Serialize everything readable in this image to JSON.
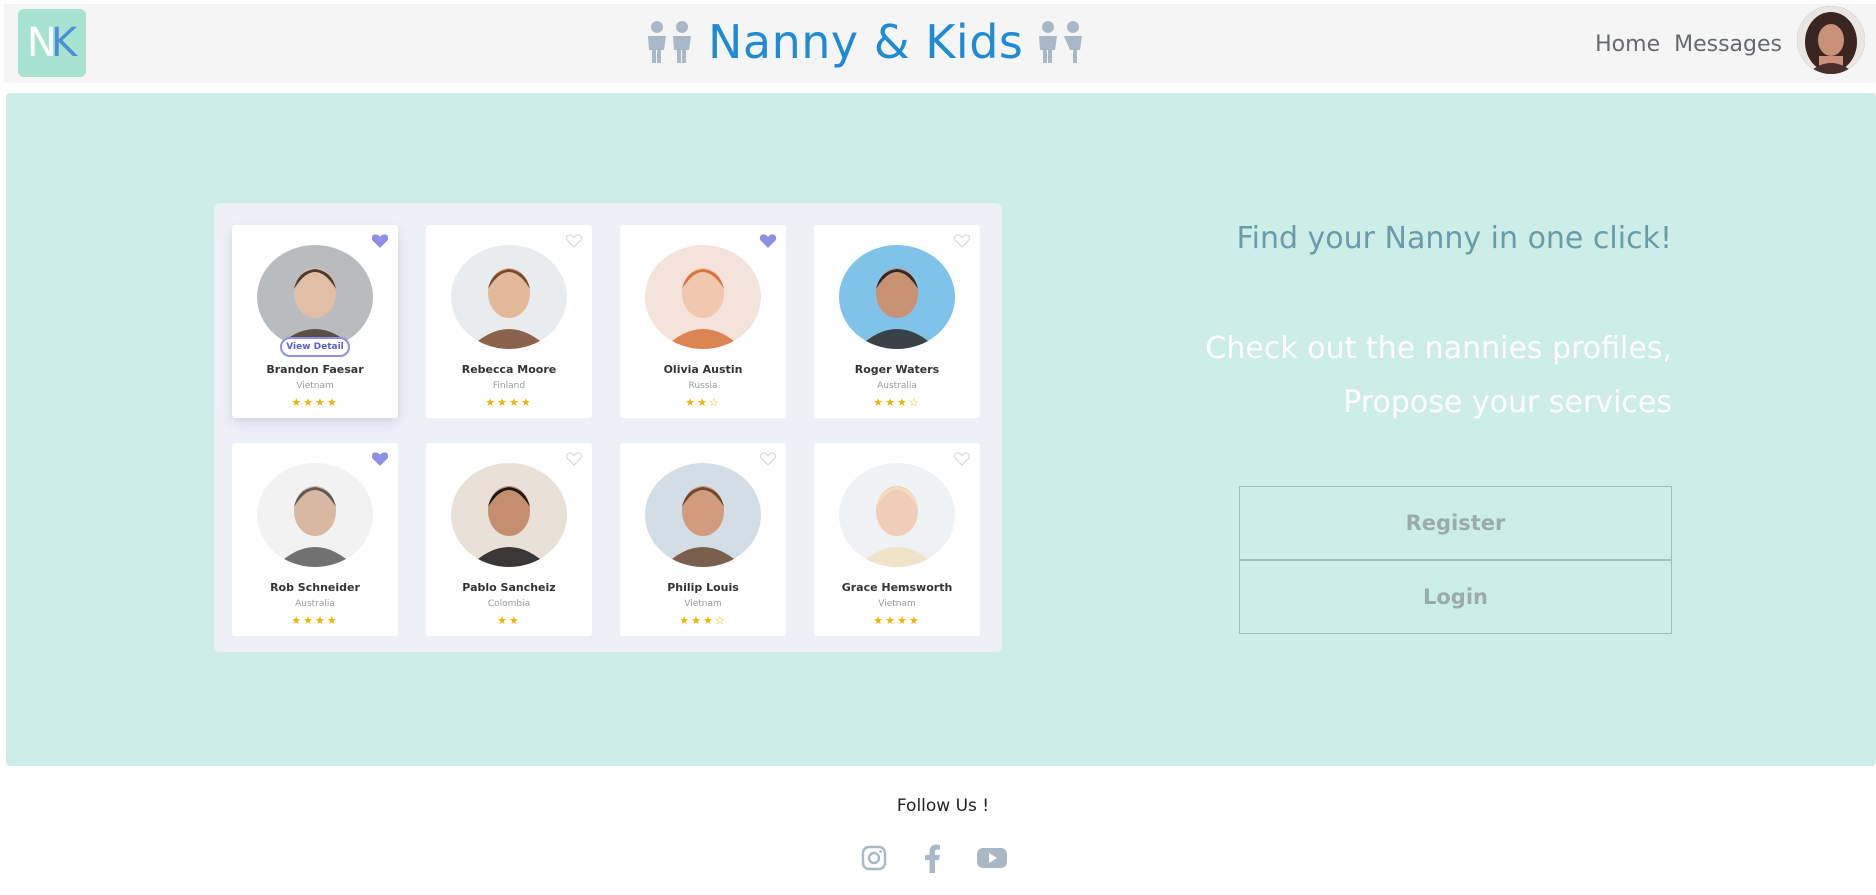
{
  "header": {
    "logo_n": "N",
    "logo_k": "K",
    "title": "Nanny & Kids",
    "nav": [
      {
        "label": "Home"
      },
      {
        "label": "Messages"
      }
    ],
    "avatar_icon": "user-avatar"
  },
  "cards": [
    {
      "name": "Brandon Faesar",
      "country": "Vietnam",
      "stars": "★★★★",
      "rating": 4,
      "favorite": true,
      "view_detail": "View Detail"
    },
    {
      "name": "Rebecca Moore",
      "country": "Finland",
      "stars": "★★★★",
      "rating": 4,
      "favorite": false
    },
    {
      "name": "Olivia Austin",
      "country": "Russia",
      "stars": "★★☆",
      "rating": 2.5,
      "favorite": true
    },
    {
      "name": "Roger Waters",
      "country": "Australia",
      "stars": "★★★☆",
      "rating": 3.5,
      "favorite": false
    },
    {
      "name": "Rob Schneider",
      "country": "Australia",
      "stars": "★★★★",
      "rating": 4,
      "favorite": true
    },
    {
      "name": "Pablo Sancheiz",
      "country": "Colombia",
      "stars": "★★",
      "rating": 2,
      "favorite": false
    },
    {
      "name": "Philip Louis",
      "country": "Vietnam",
      "stars": "★★★☆",
      "rating": 3.5,
      "favorite": false
    },
    {
      "name": "Grace Hemsworth",
      "country": "Vietnam",
      "stars": "★★★★",
      "rating": 4,
      "favorite": false
    }
  ],
  "hero": {
    "tagline": "Find your Nanny in one click!",
    "sub1": "Check out the nannies profiles,",
    "sub2": "Propose your services",
    "register_label": "Register",
    "login_label": "Login"
  },
  "footer": {
    "follow_label": "Follow Us !",
    "socials": [
      "instagram-icon",
      "facebook-icon",
      "youtube-icon"
    ]
  },
  "colors": {
    "brand_blue": "#1e8bd4",
    "hero_bg": "#cdeee8",
    "logo_bg": "#a7e3d1",
    "heart_active": "#8e8fe6",
    "star": "#f0b400"
  }
}
